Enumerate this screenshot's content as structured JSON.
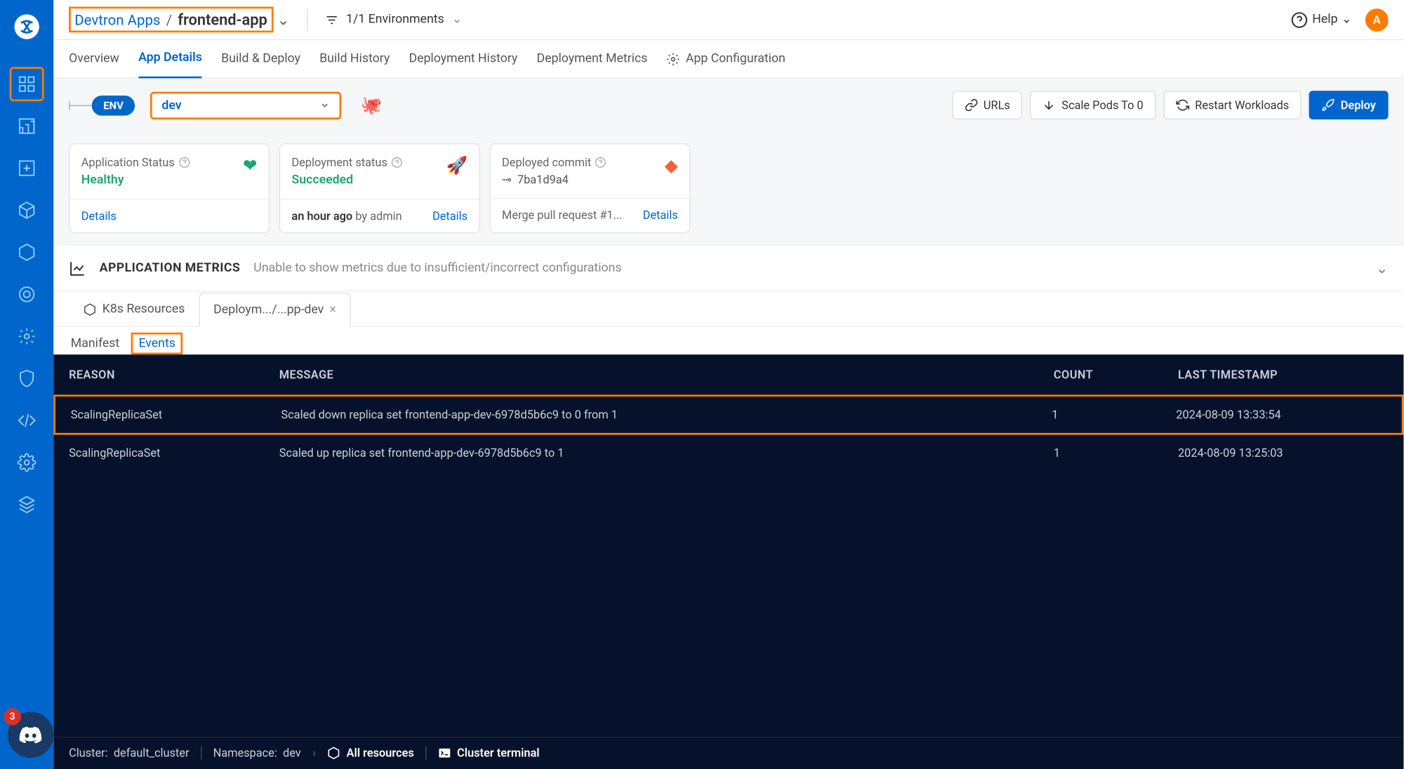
{
  "header": {
    "breadcrumb_group": "Devtron Apps",
    "breadcrumb_sep": "/",
    "breadcrumb_app": "frontend-app",
    "env_filter": "1/1 Environments",
    "help": "Help",
    "avatar_initial": "A"
  },
  "tabs": {
    "overview": "Overview",
    "app_details": "App Details",
    "build_deploy": "Build & Deploy",
    "build_history": "Build History",
    "deployment_history": "Deployment History",
    "deployment_metrics": "Deployment Metrics",
    "app_configuration": "App Configuration"
  },
  "env": {
    "label": "ENV",
    "selected": "dev"
  },
  "actions": {
    "urls": "URLs",
    "scale": "Scale Pods To 0",
    "restart": "Restart Workloads",
    "deploy": "Deploy"
  },
  "cards": {
    "app_status": {
      "label": "Application Status",
      "value": "Healthy",
      "details": "Details"
    },
    "deploy_status": {
      "label": "Deployment status",
      "value": "Succeeded",
      "time": "an hour ago",
      "by": "by admin",
      "details": "Details"
    },
    "commit": {
      "label": "Deployed commit",
      "hash": "7ba1d9a4",
      "msg": "Merge pull request #1...",
      "details": "Details"
    }
  },
  "metrics": {
    "title": "APPLICATION METRICS",
    "message": "Unable to show metrics due to insufficient/incorrect configurations"
  },
  "sub_tabs": {
    "k8s": "K8s Resources",
    "deploy_tab": "Deploym.../...pp-dev"
  },
  "inner_tabs": {
    "manifest": "Manifest",
    "events": "Events"
  },
  "events": {
    "headers": {
      "reason": "REASON",
      "message": "MESSAGE",
      "count": "COUNT",
      "ts": "LAST TIMESTAMP"
    },
    "rows": [
      {
        "reason": "ScalingReplicaSet",
        "message": "Scaled down replica set frontend-app-dev-6978d5b6c9 to 0 from 1",
        "count": "1",
        "ts": "2024-08-09 13:33:54"
      },
      {
        "reason": "ScalingReplicaSet",
        "message": "Scaled up replica set frontend-app-dev-6978d5b6c9 to 1",
        "count": "1",
        "ts": "2024-08-09 13:25:03"
      }
    ]
  },
  "footer": {
    "cluster_label": "Cluster:",
    "cluster": "default_cluster",
    "ns_label": "Namespace:",
    "ns": "dev",
    "all_resources": "All resources",
    "terminal": "Cluster terminal"
  },
  "discord_count": "3"
}
